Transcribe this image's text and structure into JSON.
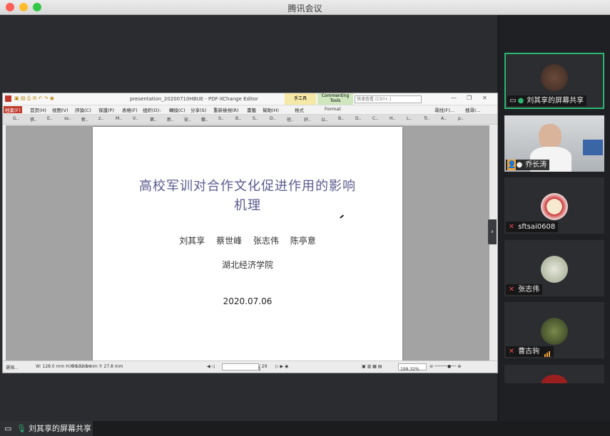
{
  "app": {
    "title": "腾讯会议"
  },
  "pdf_window": {
    "title": "presentation_20200710HBUE - PDF-XChange Editor",
    "ribbon_tab_1": "手工具",
    "ribbon_tab_1_sub": "格式",
    "ribbon_tab_2": "Commenting Tools",
    "ribbon_tab_2_sub": "Format",
    "search_placeholder": "快速查看 (Ctrl+.)",
    "menus": [
      "档案(F)",
      "首页(H)",
      "视图(V)",
      "評論(C)",
      "保護(P)",
      "表格(F)",
      "组织(O):",
      "轉換(C)",
      "分享(S)",
      "重新檢視(R)",
      "書籤",
      "幫助(H)"
    ],
    "menu_right_1": "尋找(F)...",
    "menu_right_2": "搜尋(...",
    "doc_tabs": [
      "G..",
      "張..",
      "E..",
      "ss..",
      "新..",
      "z..",
      "M..",
      "V..",
      "第..",
      "新..",
      "安..",
      "徽..",
      "S..",
      "B..",
      "S..",
      "D..",
      "径..",
      "好..",
      "以..",
      "B..",
      "D..",
      "C..",
      "H..",
      "L..",
      "Tr..",
      "A..",
      "p.."
    ],
    "page": {
      "title_line1": "高校军训对合作文化促进作用的影响",
      "title_line2": "机理",
      "authors": "刘其享 蔡世峰 张志伟 陈亭意",
      "school": "湖北经济学院",
      "date": "2020.07.06"
    },
    "status": {
      "options": "選項...",
      "dims": "W: 128.0 mm  H: 96.0 mm",
      "coords": "X: 102.1 mm  Y: 27.8 mm",
      "page_current": "1",
      "page_total": "/ 29",
      "zoom": "199.32%"
    }
  },
  "screen_share_label": "刘其享的屏幕共享",
  "participants": [
    {
      "name": "刘其享的屏幕共享",
      "active": true,
      "icon": "screen-share-icon"
    },
    {
      "name": "乔长涛",
      "active": false,
      "icon": "person-icon"
    },
    {
      "name": "sftsai0608",
      "active": false,
      "icon": "muted-mic-icon"
    },
    {
      "name": "张志伟",
      "active": false,
      "icon": "muted-mic-icon"
    },
    {
      "name": "曹古驹",
      "active": false,
      "icon": "muted-mic-icon"
    }
  ],
  "colors": {
    "accent_green": "#2bb673",
    "speaking_orange": "#f0a13a",
    "close_red": "#fc5f57"
  }
}
